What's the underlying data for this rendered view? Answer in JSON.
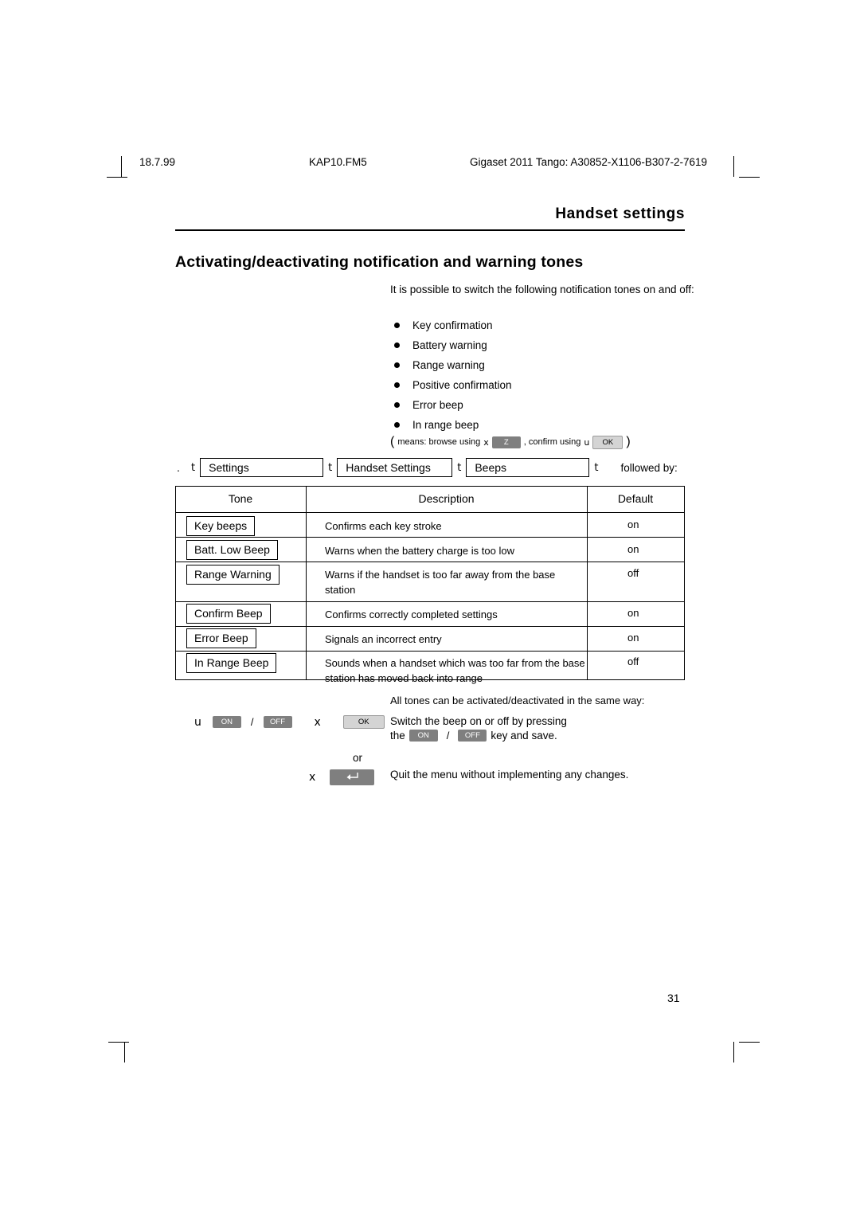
{
  "header": {
    "date": "18.7.99",
    "file": "KAP10.FM5",
    "ident": "Gigaset 2011 Tango: A30852-X1106-B307-2-7619"
  },
  "chapter_title": "Handset settings",
  "heading": "Activating/deactivating notification and warning tones",
  "intro": "It is possible to switch the following notification tones on and off:",
  "bullets": [
    "Key confirmation",
    "Battery warning",
    "Range warning",
    "Positive confirmation",
    "Error beep",
    "In range beep"
  ],
  "legend": {
    "open_paren": "(",
    "text_1": "means: browse using",
    "key_browse_symbol": "x",
    "key_browse_label": "Z",
    "text_2": ", confirm using",
    "key_confirm_symbol": "u",
    "key_confirm_label": "OK",
    "close_paren": ")"
  },
  "nav": {
    "lead_symbol": ".",
    "arrow": "t",
    "items": [
      "Settings",
      "Handset Settings",
      "Beeps"
    ],
    "followed_by": "followed by:"
  },
  "table": {
    "headers": [
      "Tone",
      "Description",
      "Default"
    ],
    "rows": [
      {
        "tone": "Key beeps",
        "description": "Confirms each key stroke",
        "default": "on"
      },
      {
        "tone": "Batt. Low Beep",
        "description": "Warns when the battery charge is too low",
        "default": "on"
      },
      {
        "tone": "Range Warning",
        "description": "Warns if the handset is too far away from the base station",
        "default": "off"
      },
      {
        "tone": "Confirm Beep",
        "description": "Confirms correctly completed settings",
        "default": "on"
      },
      {
        "tone": "Error Beep",
        "description": "Signals an incorrect entry",
        "default": "on"
      },
      {
        "tone": "In Range Beep",
        "description": "Sounds when a handset which was too far from the base station has moved back into range",
        "default": "off"
      }
    ]
  },
  "footer_note": "All tones can be activated/deactivated in the same way:",
  "actions": {
    "row1": {
      "key_symbol": "u",
      "on_label": "ON",
      "slash": "/",
      "off_label": "OFF",
      "key2_symbol": "x",
      "ok_label": "OK",
      "text_line1": "Switch the beep on or off by pressing",
      "text_line2_pre": "the",
      "text_on": "ON",
      "text_slash": "/",
      "text_off": "OFF",
      "text_line2_post": "key and save."
    },
    "or": "or",
    "row2": {
      "key_symbol": "x",
      "icon_label": "back-arrow",
      "text": "Quit the menu without implementing any changes."
    }
  },
  "page_number": "31"
}
